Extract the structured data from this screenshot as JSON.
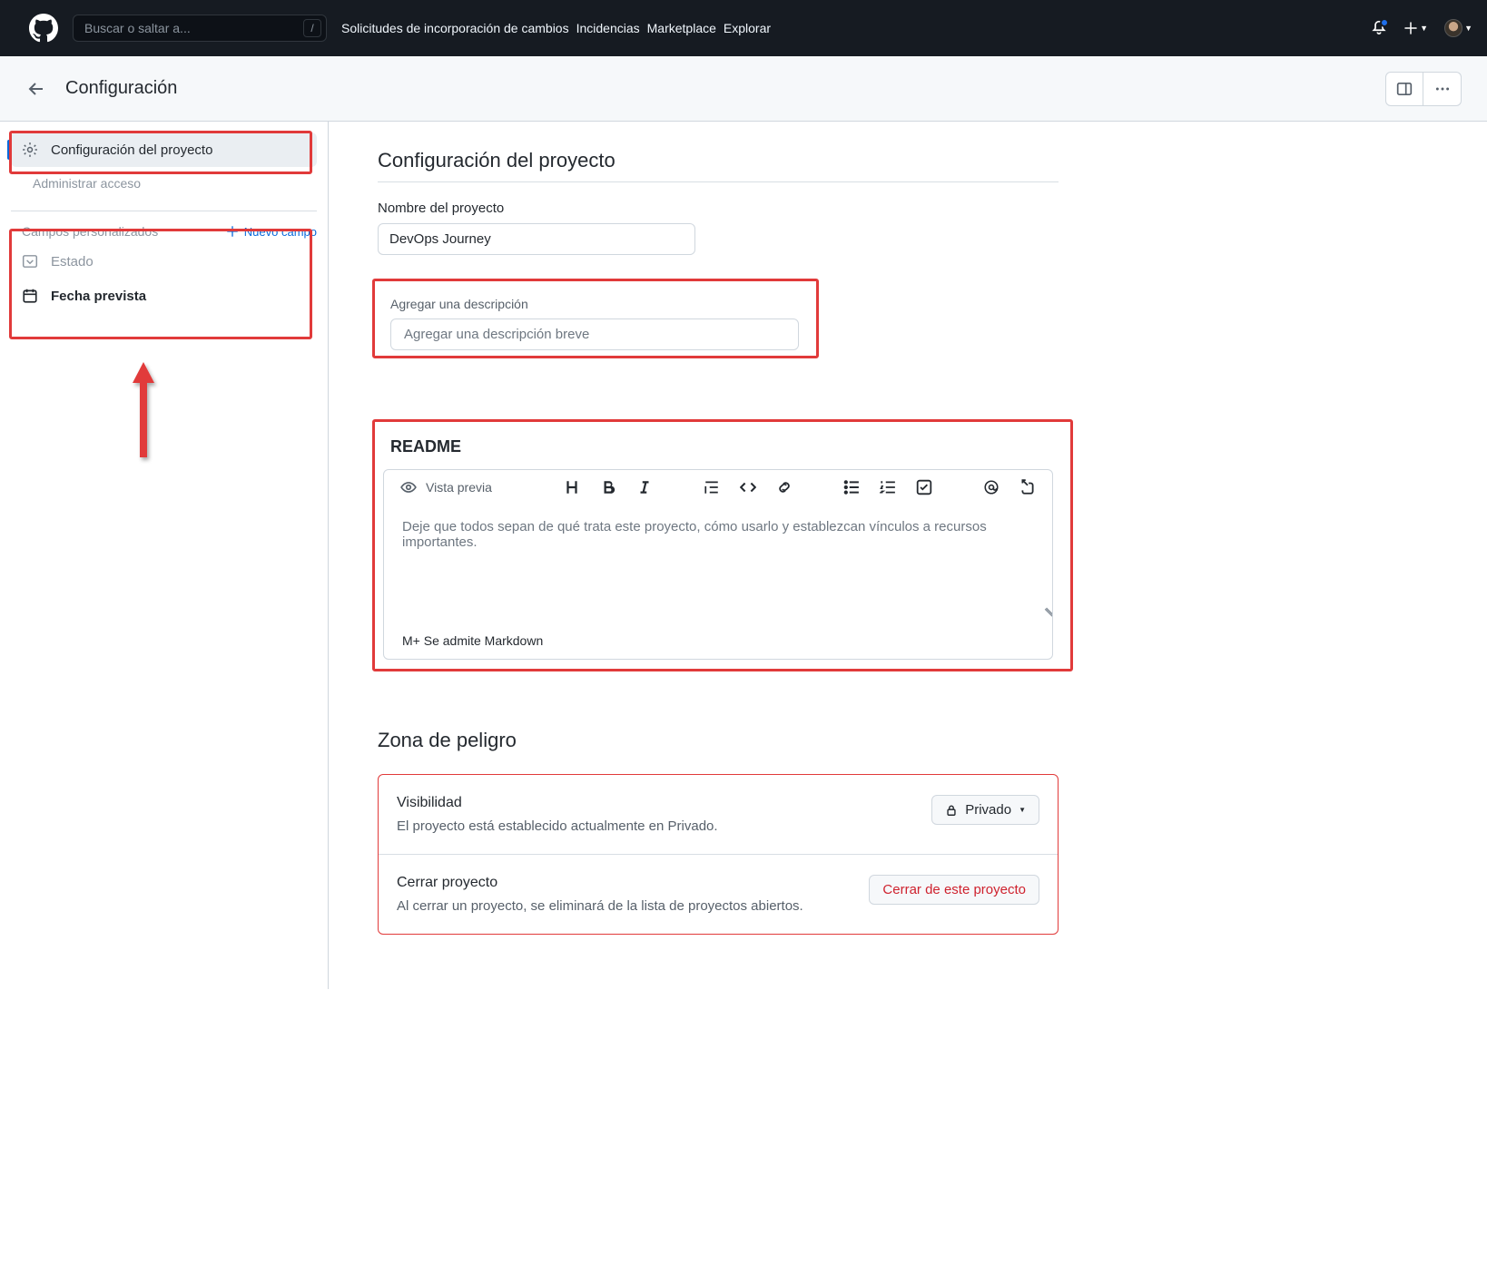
{
  "header": {
    "search_placeholder": "Buscar o saltar a...",
    "slash": "/",
    "nav": {
      "pulls": "Solicitudes de incorporación de cambios",
      "issues": "Incidencias",
      "marketplace": "Marketplace",
      "explore": "Explorar"
    }
  },
  "pagebar": {
    "title": "Configuración"
  },
  "sidebar": {
    "project_settings": "Configuración del proyecto",
    "manage_access": "Administrar acceso",
    "custom_fields_header": "Campos personalizados",
    "new_field": "Nuevo campo",
    "field_status": "Estado",
    "field_date": "Fecha prevista"
  },
  "main": {
    "section_title": "Configuración del proyecto",
    "name_label": "Nombre del proyecto",
    "name_value": "DevOps Journey",
    "desc_label": "Agregar una descripción",
    "desc_placeholder": "Agregar una descripción breve",
    "readme_title": "README",
    "preview_label": "Vista previa",
    "readme_placeholder": "Deje que todos sepan de qué trata este proyecto, cómo usarlo y establezcan vínculos a recursos importantes.",
    "markdown_note": "M+ Se admite Markdown",
    "danger_title": "Zona de peligro",
    "visibility": {
      "title": "Visibilidad",
      "desc": "El proyecto está establecido actualmente en Privado.",
      "button": "Privado"
    },
    "close": {
      "title": "Cerrar proyecto",
      "desc": "Al cerrar un proyecto, se eliminará de la lista de proyectos abiertos.",
      "button": "Cerrar de este proyecto"
    }
  }
}
